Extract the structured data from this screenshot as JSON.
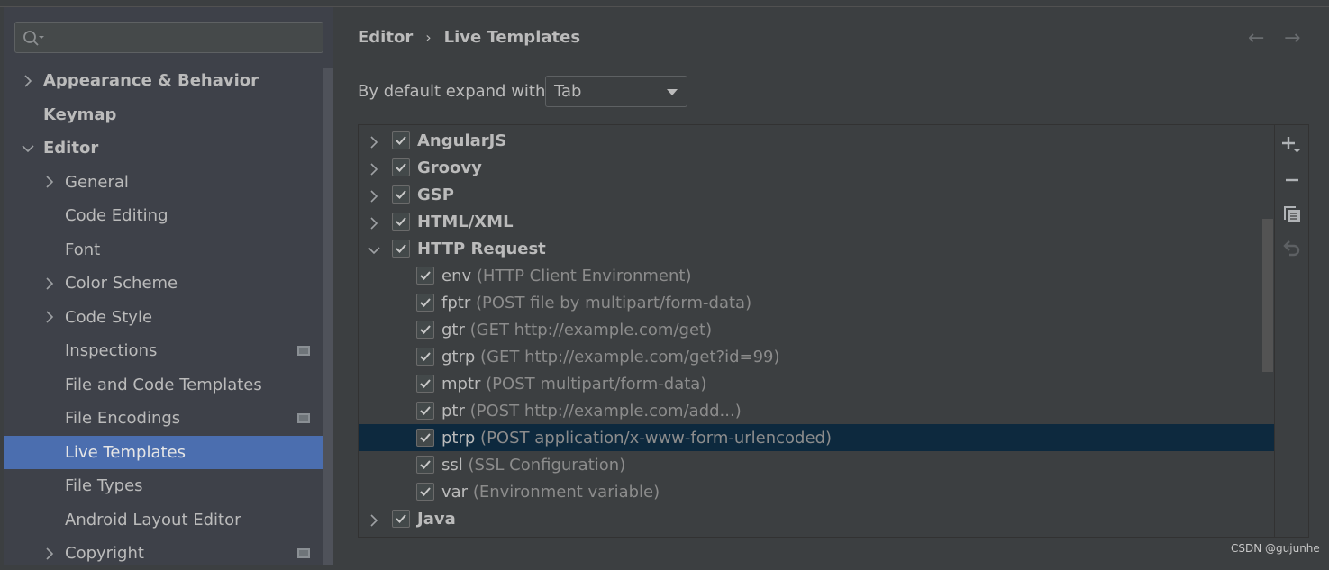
{
  "sidebar": {
    "search": {
      "placeholder": "",
      "value": ""
    },
    "items": [
      {
        "label": "Appearance & Behavior",
        "bold": true,
        "chevron": "right",
        "indent": 0
      },
      {
        "label": "Keymap",
        "bold": true,
        "chevron": "none",
        "indent": 0
      },
      {
        "label": "Editor",
        "bold": true,
        "chevron": "down",
        "indent": 0
      },
      {
        "label": "General",
        "chevron": "right",
        "indent": 1
      },
      {
        "label": "Code Editing",
        "chevron": "none",
        "indent": 1
      },
      {
        "label": "Font",
        "chevron": "none",
        "indent": 1
      },
      {
        "label": "Color Scheme",
        "chevron": "right",
        "indent": 1
      },
      {
        "label": "Code Style",
        "chevron": "right",
        "indent": 1
      },
      {
        "label": "Inspections",
        "chevron": "none",
        "indent": 1,
        "project_icon": true
      },
      {
        "label": "File and Code Templates",
        "chevron": "none",
        "indent": 1
      },
      {
        "label": "File Encodings",
        "chevron": "none",
        "indent": 1,
        "project_icon": true
      },
      {
        "label": "Live Templates",
        "chevron": "none",
        "indent": 1,
        "selected": true
      },
      {
        "label": "File Types",
        "chevron": "none",
        "indent": 1
      },
      {
        "label": "Android Layout Editor",
        "chevron": "none",
        "indent": 1
      },
      {
        "label": "Copyright",
        "chevron": "right",
        "indent": 1,
        "project_icon": true
      }
    ]
  },
  "breadcrumb": {
    "parent": "Editor",
    "separator": "›",
    "current": "Live Templates"
  },
  "nav": {
    "back_icon": "arrow-left-icon",
    "forward_icon": "arrow-right-icon",
    "back": "←",
    "forward": "→"
  },
  "expand": {
    "label": "By default expand with",
    "value": "Tab"
  },
  "templates": [
    {
      "name": "AngularJS",
      "group": true,
      "expanded": false,
      "checked": true
    },
    {
      "name": "Groovy",
      "group": true,
      "expanded": false,
      "checked": true
    },
    {
      "name": "GSP",
      "group": true,
      "expanded": false,
      "checked": true
    },
    {
      "name": "HTML/XML",
      "group": true,
      "expanded": false,
      "checked": true
    },
    {
      "name": "HTTP Request",
      "group": true,
      "expanded": true,
      "checked": true
    },
    {
      "name": "env",
      "desc": "(HTTP Client Environment)",
      "checked": true
    },
    {
      "name": "fptr",
      "desc": "(POST file by multipart/form-data)",
      "checked": true
    },
    {
      "name": "gtr",
      "desc": "(GET http://example.com/get)",
      "checked": true
    },
    {
      "name": "gtrp",
      "desc": "(GET http://example.com/get?id=99)",
      "checked": true
    },
    {
      "name": "mptr",
      "desc": "(POST multipart/form-data)",
      "checked": true
    },
    {
      "name": "ptr",
      "desc": "(POST http://example.com/add...)",
      "checked": true
    },
    {
      "name": "ptrp",
      "desc": "(POST application/x-www-form-urlencoded)",
      "checked": true,
      "selected": true
    },
    {
      "name": "ssl",
      "desc": "(SSL Configuration)",
      "checked": true
    },
    {
      "name": "var",
      "desc": "(Environment variable)",
      "checked": true
    },
    {
      "name": "Java",
      "group": true,
      "expanded": false,
      "checked": true
    }
  ],
  "toolbar": [
    "add-icon",
    "remove-icon",
    "copy-icon",
    "restore-icon"
  ],
  "watermark": "CSDN @gujunhe",
  "colors": {
    "selection": "#4b6eaf",
    "row_selection": "#0d293e"
  }
}
